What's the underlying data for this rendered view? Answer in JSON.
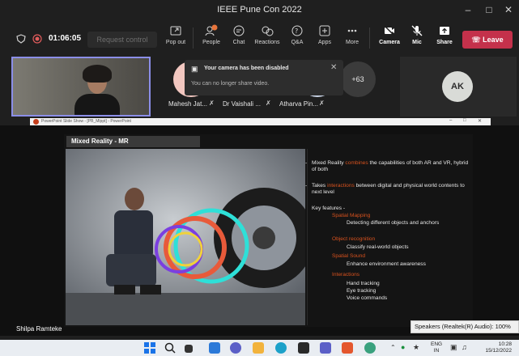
{
  "window": {
    "title": "IEEE Pune Con 2022"
  },
  "meeting": {
    "timer": "01:06:05",
    "request_control": "Request control",
    "toolbar": [
      {
        "label": "Pop out",
        "icon": "popout-icon"
      },
      {
        "label": "People",
        "icon": "people-icon",
        "badge": "13"
      },
      {
        "label": "Chat",
        "icon": "chat-icon"
      },
      {
        "label": "Reactions",
        "icon": "reactions-icon"
      },
      {
        "label": "Q&A",
        "icon": "qa-icon"
      },
      {
        "label": "Apps",
        "icon": "apps-icon"
      },
      {
        "label": "More",
        "icon": "more-icon"
      },
      {
        "label": "Camera",
        "icon": "camera-off-icon"
      },
      {
        "label": "Mic",
        "icon": "mic-off-icon"
      },
      {
        "label": "Share",
        "icon": "share-icon"
      }
    ],
    "leave_label": "Leave"
  },
  "participants": {
    "names": [
      "Mahesh Jat...",
      "Dr Vaishali ...",
      "Atharva Pin..."
    ],
    "overflow": "+63",
    "ak_initials": "AK"
  },
  "notification": {
    "title": "Your camera has been disabled",
    "body": "You can no longer share video."
  },
  "ppt": {
    "window_title": "PowerPoint Slide Show - [PB_Mlppt] - PowerPoint",
    "slide_title": "Mixed Reality - MR",
    "presenter": "Shilpa Ramteke",
    "p1_pre": "Mixed Reality ",
    "p1_hl": "combines",
    "p1_post": " the capabilities of both AR and VR, hybrid of both",
    "p2_pre": "Takes ",
    "p2_hl": "interactions",
    "p2_post": " between digital and physical world contents to next level",
    "key": "Key features -",
    "f1": "Spatial Mapping",
    "f1a": "Detecting different objects and anchors",
    "f2": "Object recognition",
    "f2a": "Classify real-world objects",
    "f3": "Spatial Sound",
    "f3a": "Enhance environment awareness",
    "f4": "Interactions",
    "f4a": "Hand tracking",
    "f4b": "Eye tracking",
    "f4c": "Voice commands"
  },
  "speakers_tooltip": "Speakers (Realtek(R) Audio): 100%",
  "taskbar": {
    "lang": "ENG",
    "lang2": "IN",
    "time": "10:28",
    "date": "15/12/2022"
  },
  "colors": {
    "accent": "#8b8ee8",
    "leave": "#c4314b",
    "highlight": "#d8521e"
  }
}
